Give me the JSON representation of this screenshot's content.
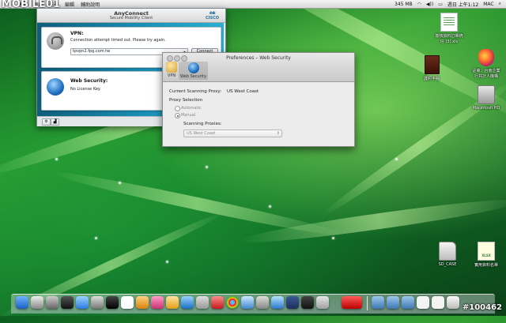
{
  "menubar": {
    "logo": "MOBILE01",
    "menus": [
      "連線",
      "網頁",
      "前往",
      "編輯",
      "輔助說明"
    ],
    "status": {
      "network_speed": "345 MB",
      "day_time": "週日 上午1:12",
      "user": "MAC"
    }
  },
  "anyconnect": {
    "title": "AnyConnect",
    "subtitle": "Secure Mobility Client",
    "brand": "CISCO",
    "vpn": {
      "label": "VPN:",
      "message": "Connection attempt timed out. Please try again.",
      "server_value": "tpvpn2.fpg.com.tw",
      "connect_label": "Connect"
    },
    "web_security": {
      "label": "Web Security:",
      "message": "No License Key."
    }
  },
  "preferences": {
    "title": "Preferences – Web Security",
    "tabs": [
      {
        "label": "VPN",
        "icon": "lock-icon"
      },
      {
        "label": "Web Security",
        "icon": "globe-icon"
      }
    ],
    "current_proxy_label": "Current Scanning Proxy:",
    "current_proxy_value": "US West Coast",
    "proxy_selection_label": "Proxy Selection",
    "option_automatic": "Automatic",
    "option_manual": "Manual",
    "scanning_proxies_label": "Scanning Proxies:",
    "scanning_proxies_value": "US West Coast"
  },
  "desktop_icons": [
    {
      "label": "簽核資料訂單統\n信 (3).xls",
      "icon": "spreadsheet-doc-icon"
    },
    {
      "label": "護照手冊",
      "icon": "passport-icon"
    },
    {
      "label": "註冊：台南企業\n行共計人機構",
      "icon": "apple-rainbow-icon"
    },
    {
      "label": "Macintosh HD",
      "icon": "hard-drive-icon"
    },
    {
      "label": "SD_CASE",
      "icon": "sd-card-icon"
    },
    {
      "label": "實用資料名單",
      "icon": "xlsx-icon"
    }
  ],
  "watermark": "#100462",
  "colors": {
    "desktop_green": "#1f8a2c",
    "cisco_blue": "#2b6fa1",
    "panel_teal": "#1a93b8"
  }
}
